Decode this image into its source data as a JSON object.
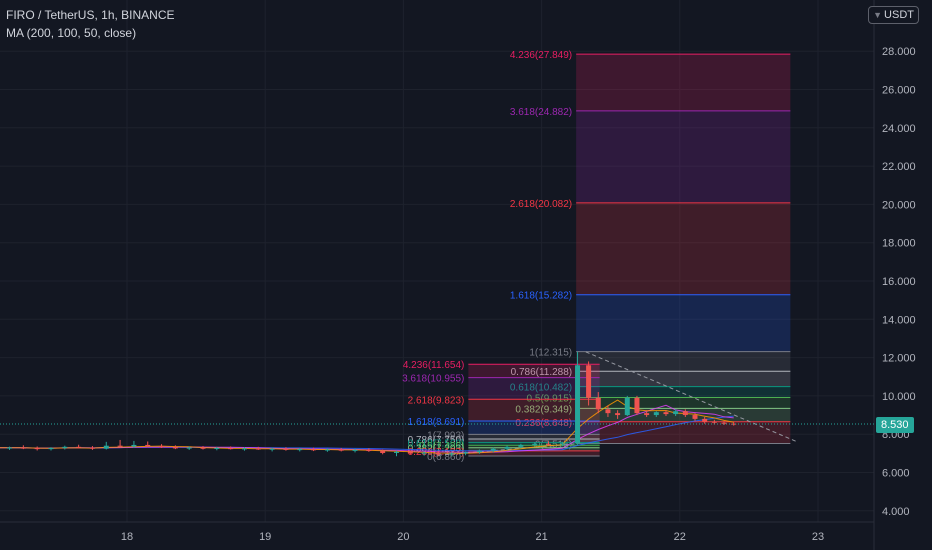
{
  "header": {
    "symbol_line": "FIRO / TetherUS, 1h, BINANCE",
    "indicator_line": "MA (200, 100, 50, close)"
  },
  "currency_badge": {
    "label": "USDT",
    "icon": "chevron-down-icon"
  },
  "last_price_label": "8.530",
  "colors": {
    "background": "#131722",
    "grid": "#1e222d",
    "up": "#26a69a",
    "down": "#ef5350",
    "axis_text": "#b2b5be"
  },
  "chart_data": {
    "type": "candlestick",
    "title": "FIRO / TetherUS, 1h, BINANCE",
    "ylim": [
      3.5,
      29
    ],
    "y_ticks": [
      "4.000",
      "6.000",
      "8.000",
      "10.000",
      "12.000",
      "14.000",
      "16.000",
      "18.000",
      "20.000",
      "22.000",
      "24.000",
      "26.000",
      "28.000"
    ],
    "x_ticks": [
      "18",
      "19",
      "20",
      "21",
      "22",
      "23"
    ],
    "last_price": 8.53,
    "moving_averages": [
      "MA 200",
      "MA 100",
      "MA 50"
    ],
    "fib_extension_large": {
      "start_day": 21.25,
      "end_day": 22.8,
      "levels": [
        {
          "label": "4.236(27.849)",
          "price": 27.849,
          "color": "#e91e63"
        },
        {
          "label": "3.618(24.882)",
          "price": 24.882,
          "color": "#9c27b0"
        },
        {
          "label": "2.618(20.082)",
          "price": 20.082,
          "color": "#f23645"
        },
        {
          "label": "1.618(15.282)",
          "price": 15.282,
          "color": "#2962ff"
        },
        {
          "label": "1(12.315)",
          "price": 12.315,
          "color": "#787b86"
        },
        {
          "label": "0.786(11.288)",
          "price": 11.288,
          "color": "#b2b5be"
        },
        {
          "label": "0.618(10.482)",
          "price": 10.482,
          "color": "#089981"
        },
        {
          "label": "0.5(9.915)",
          "price": 9.915,
          "color": "#4caf50"
        },
        {
          "label": "0.382(9.349)",
          "price": 9.349,
          "color": "#81c784"
        },
        {
          "label": "0.236(8.648)",
          "price": 8.648,
          "color": "#f23645"
        },
        {
          "label": "0(7.515)",
          "price": 7.515,
          "color": "#787b86"
        }
      ]
    },
    "fib_extension_small": {
      "start_day": 20.47,
      "end_day": 21.42,
      "levels": [
        {
          "label": "4.236(11.654)",
          "price": 11.654,
          "color": "#e91e63"
        },
        {
          "label": "3.618(10.955)",
          "price": 10.955,
          "color": "#9c27b0"
        },
        {
          "label": "2.618(9.823)",
          "price": 9.823,
          "color": "#f23645"
        },
        {
          "label": "1.618(8.691)",
          "price": 8.691,
          "color": "#2962ff"
        },
        {
          "label": "1(7.993)",
          "price": 7.993,
          "color": "#787b86"
        },
        {
          "label": "0.786(7.750)",
          "price": 7.75,
          "color": "#b2b5be"
        },
        {
          "label": "0.618(7.560)",
          "price": 7.56,
          "color": "#089981"
        },
        {
          "label": "0.5(7.426)",
          "price": 7.426,
          "color": "#4caf50"
        },
        {
          "label": "0.382(7.293)",
          "price": 7.293,
          "color": "#81c784"
        },
        {
          "label": "0.236(7.127)",
          "price": 7.127,
          "color": "#f23645"
        },
        {
          "label": "0(6.860)",
          "price": 6.86,
          "color": "#787b86"
        }
      ]
    },
    "trendlines": [
      {
        "from": [
          21.32,
          12.3
        ],
        "to": [
          22.85,
          7.6
        ]
      },
      {
        "from": [
          20.25,
          6.9
        ],
        "to": [
          21.25,
          7.5
        ]
      }
    ],
    "candles": [
      {
        "t": 16.95,
        "o": 7.3,
        "h": 7.4,
        "l": 7.25,
        "c": 7.32
      },
      {
        "t": 17.05,
        "o": 7.32,
        "h": 7.38,
        "l": 7.2,
        "c": 7.26
      },
      {
        "t": 17.15,
        "o": 7.26,
        "h": 7.35,
        "l": 7.18,
        "c": 7.3
      },
      {
        "t": 17.25,
        "o": 7.3,
        "h": 7.42,
        "l": 7.22,
        "c": 7.28
      },
      {
        "t": 17.35,
        "o": 7.28,
        "h": 7.36,
        "l": 7.15,
        "c": 7.22
      },
      {
        "t": 17.45,
        "o": 7.22,
        "h": 7.32,
        "l": 7.15,
        "c": 7.28
      },
      {
        "t": 17.55,
        "o": 7.28,
        "h": 7.4,
        "l": 7.2,
        "c": 7.34
      },
      {
        "t": 17.65,
        "o": 7.34,
        "h": 7.45,
        "l": 7.26,
        "c": 7.3
      },
      {
        "t": 17.75,
        "o": 7.3,
        "h": 7.38,
        "l": 7.18,
        "c": 7.24
      },
      {
        "t": 17.85,
        "o": 7.24,
        "h": 7.6,
        "l": 7.2,
        "c": 7.4
      },
      {
        "t": 17.95,
        "o": 7.4,
        "h": 7.7,
        "l": 7.3,
        "c": 7.36
      },
      {
        "t": 18.05,
        "o": 7.36,
        "h": 7.65,
        "l": 7.3,
        "c": 7.44
      },
      {
        "t": 18.15,
        "o": 7.44,
        "h": 7.62,
        "l": 7.32,
        "c": 7.38
      },
      {
        "t": 18.25,
        "o": 7.38,
        "h": 7.48,
        "l": 7.28,
        "c": 7.32
      },
      {
        "t": 18.35,
        "o": 7.32,
        "h": 7.42,
        "l": 7.22,
        "c": 7.26
      },
      {
        "t": 18.45,
        "o": 7.26,
        "h": 7.36,
        "l": 7.18,
        "c": 7.3
      },
      {
        "t": 18.55,
        "o": 7.3,
        "h": 7.38,
        "l": 7.2,
        "c": 7.24
      },
      {
        "t": 18.65,
        "o": 7.24,
        "h": 7.34,
        "l": 7.16,
        "c": 7.28
      },
      {
        "t": 18.75,
        "o": 7.28,
        "h": 7.36,
        "l": 7.2,
        "c": 7.22
      },
      {
        "t": 18.85,
        "o": 7.22,
        "h": 7.32,
        "l": 7.14,
        "c": 7.26
      },
      {
        "t": 18.95,
        "o": 7.26,
        "h": 7.34,
        "l": 7.18,
        "c": 7.2
      },
      {
        "t": 19.05,
        "o": 7.2,
        "h": 7.3,
        "l": 7.1,
        "c": 7.24
      },
      {
        "t": 19.15,
        "o": 7.24,
        "h": 7.32,
        "l": 7.14,
        "c": 7.18
      },
      {
        "t": 19.25,
        "o": 7.18,
        "h": 7.28,
        "l": 7.1,
        "c": 7.22
      },
      {
        "t": 19.35,
        "o": 7.22,
        "h": 7.3,
        "l": 7.12,
        "c": 7.16
      },
      {
        "t": 19.45,
        "o": 7.16,
        "h": 7.26,
        "l": 7.08,
        "c": 7.2
      },
      {
        "t": 19.55,
        "o": 7.2,
        "h": 7.28,
        "l": 7.1,
        "c": 7.14
      },
      {
        "t": 19.65,
        "o": 7.14,
        "h": 7.24,
        "l": 7.05,
        "c": 7.18
      },
      {
        "t": 19.75,
        "o": 7.18,
        "h": 7.26,
        "l": 7.08,
        "c": 7.12
      },
      {
        "t": 19.85,
        "o": 7.12,
        "h": 7.2,
        "l": 6.95,
        "c": 7.02
      },
      {
        "t": 19.95,
        "o": 7.02,
        "h": 7.14,
        "l": 6.85,
        "c": 7.08
      },
      {
        "t": 20.05,
        "o": 7.08,
        "h": 7.16,
        "l": 6.95,
        "c": 7.0
      },
      {
        "t": 20.15,
        "o": 7.0,
        "h": 7.1,
        "l": 6.88,
        "c": 7.04
      },
      {
        "t": 20.25,
        "o": 7.04,
        "h": 7.12,
        "l": 6.86,
        "c": 6.94
      },
      {
        "t": 20.35,
        "o": 6.94,
        "h": 7.05,
        "l": 6.86,
        "c": 7.0
      },
      {
        "t": 20.45,
        "o": 7.0,
        "h": 7.1,
        "l": 6.9,
        "c": 7.06
      },
      {
        "t": 20.55,
        "o": 7.06,
        "h": 7.2,
        "l": 6.98,
        "c": 7.14
      },
      {
        "t": 20.65,
        "o": 7.14,
        "h": 7.3,
        "l": 7.06,
        "c": 7.24
      },
      {
        "t": 20.75,
        "o": 7.24,
        "h": 7.4,
        "l": 7.16,
        "c": 7.34
      },
      {
        "t": 20.85,
        "o": 7.34,
        "h": 7.5,
        "l": 7.26,
        "c": 7.44
      },
      {
        "t": 20.95,
        "o": 7.44,
        "h": 7.58,
        "l": 7.36,
        "c": 7.5
      },
      {
        "t": 21.05,
        "o": 7.5,
        "h": 7.62,
        "l": 7.4,
        "c": 7.46
      },
      {
        "t": 21.15,
        "o": 7.46,
        "h": 7.6,
        "l": 7.38,
        "c": 7.52
      },
      {
        "t": 21.26,
        "o": 7.52,
        "h": 12.3,
        "l": 7.45,
        "c": 11.6
      },
      {
        "t": 21.34,
        "o": 11.6,
        "h": 11.8,
        "l": 9.5,
        "c": 9.9
      },
      {
        "t": 21.41,
        "o": 9.9,
        "h": 10.2,
        "l": 9.1,
        "c": 9.3
      },
      {
        "t": 21.48,
        "o": 9.3,
        "h": 9.5,
        "l": 8.9,
        "c": 9.1
      },
      {
        "t": 21.55,
        "o": 9.1,
        "h": 9.25,
        "l": 8.8,
        "c": 9.0
      },
      {
        "t": 21.62,
        "o": 9.0,
        "h": 10.0,
        "l": 8.95,
        "c": 9.9
      },
      {
        "t": 21.69,
        "o": 9.9,
        "h": 10.0,
        "l": 9.0,
        "c": 9.1
      },
      {
        "t": 21.76,
        "o": 9.1,
        "h": 9.25,
        "l": 8.9,
        "c": 9.0
      },
      {
        "t": 21.83,
        "o": 9.0,
        "h": 9.2,
        "l": 8.9,
        "c": 9.15
      },
      {
        "t": 21.9,
        "o": 9.15,
        "h": 9.25,
        "l": 8.95,
        "c": 9.05
      },
      {
        "t": 21.97,
        "o": 9.05,
        "h": 9.3,
        "l": 8.95,
        "c": 9.2
      },
      {
        "t": 22.04,
        "o": 9.2,
        "h": 9.3,
        "l": 8.9,
        "c": 9.0
      },
      {
        "t": 22.11,
        "o": 9.0,
        "h": 9.1,
        "l": 8.7,
        "c": 8.8
      },
      {
        "t": 22.18,
        "o": 8.8,
        "h": 8.9,
        "l": 8.55,
        "c": 8.65
      },
      {
        "t": 22.25,
        "o": 8.65,
        "h": 8.75,
        "l": 8.5,
        "c": 8.6
      },
      {
        "t": 22.32,
        "o": 8.6,
        "h": 8.68,
        "l": 8.48,
        "c": 8.55
      },
      {
        "t": 22.39,
        "o": 8.55,
        "h": 8.62,
        "l": 8.45,
        "c": 8.53
      }
    ]
  }
}
